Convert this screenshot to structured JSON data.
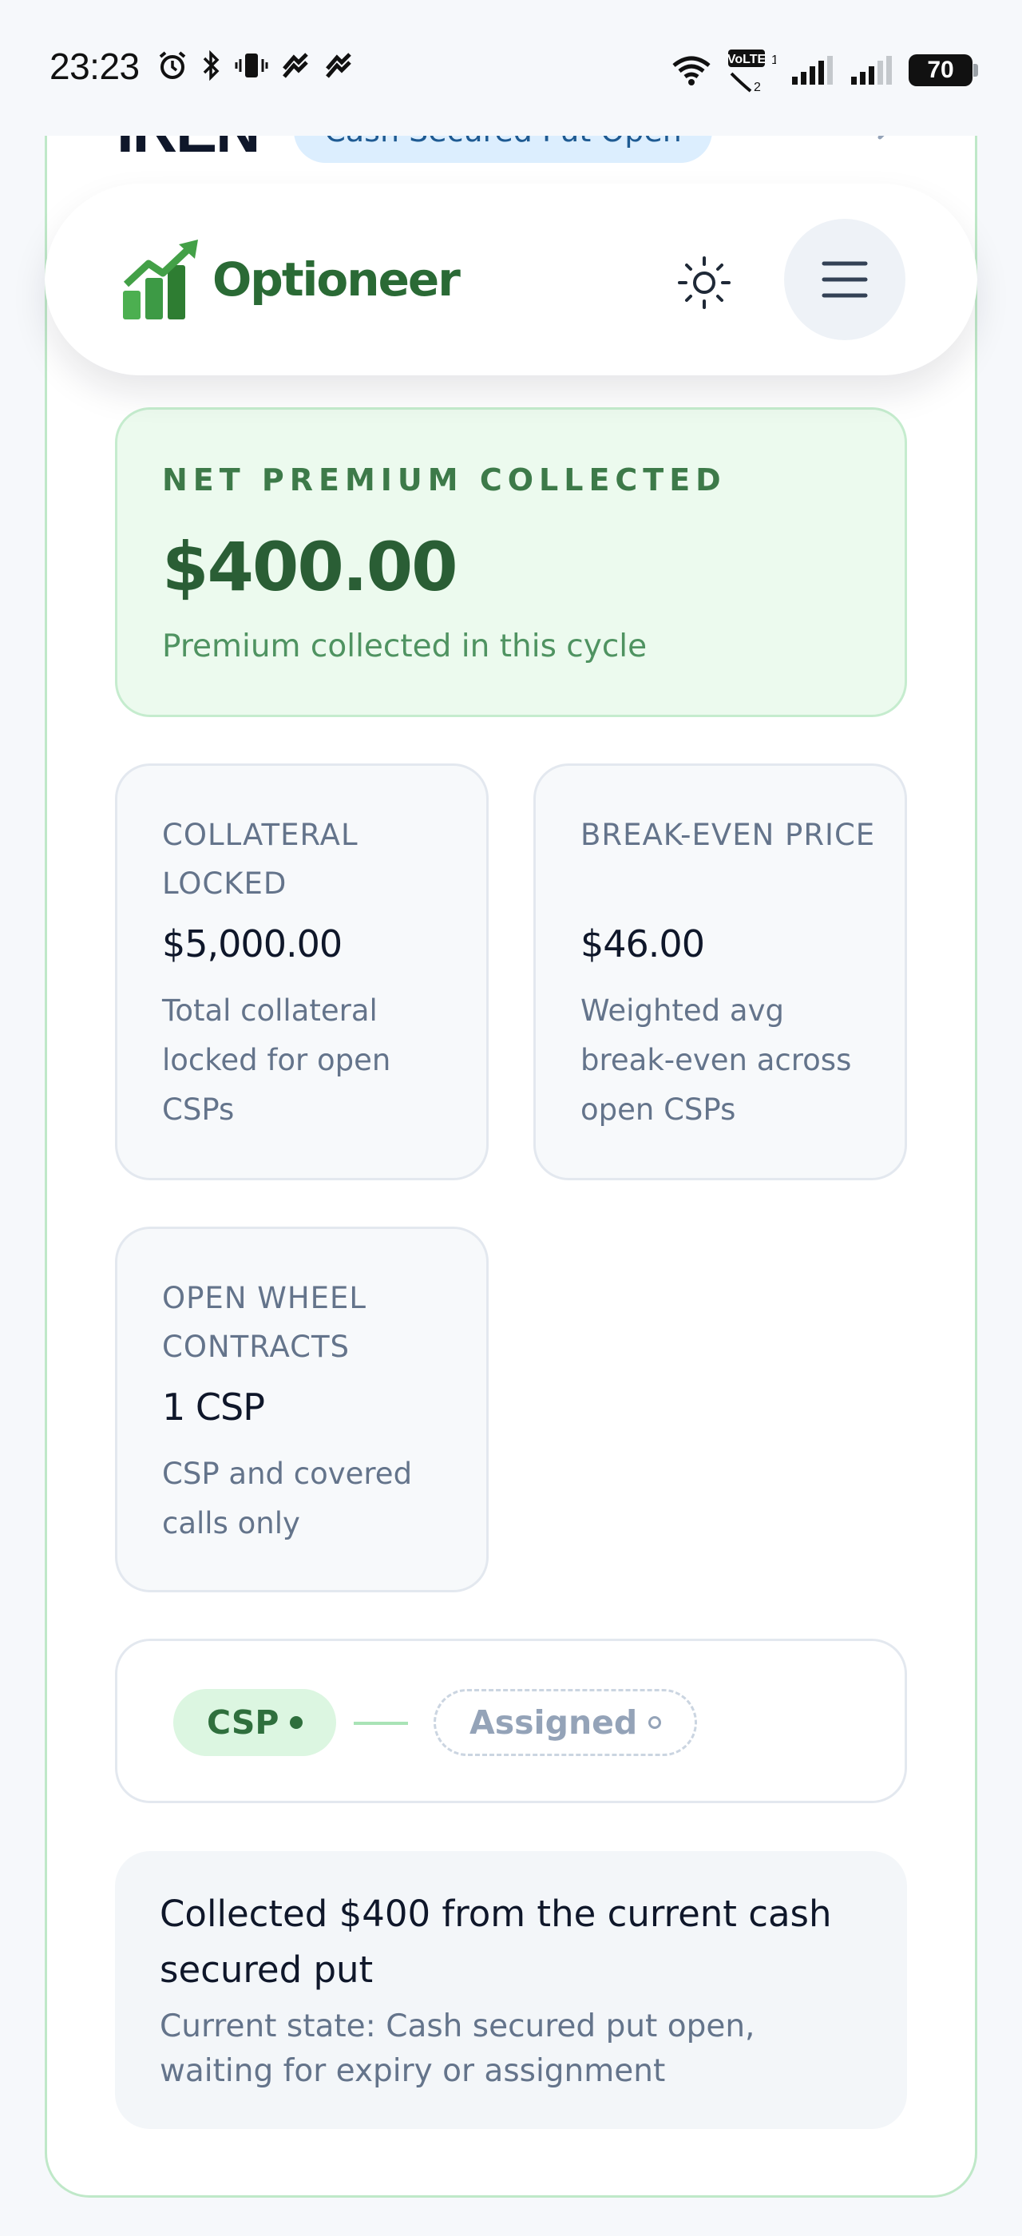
{
  "status_bar": {
    "time": "23:23",
    "left_icons": [
      "alarm-icon",
      "bluetooth-icon",
      "vibrate-icon",
      "signal-tie-icon",
      "signal-tie-icon"
    ],
    "right_icons": [
      "wifi-icon",
      "volte-icon",
      "signal-bars-icon",
      "signal-bars-icon"
    ],
    "volte_label": "VoLTE",
    "battery": "70"
  },
  "position": {
    "ticker": "IREN",
    "status": "Cash Secured Put Open"
  },
  "header": {
    "brand": "Optioneer",
    "theme_icon": "sun-icon",
    "menu_icon": "hamburger-icon"
  },
  "premium": {
    "label": "NET PREMIUM COLLECTED",
    "value": "$400.00",
    "sub": "Premium collected in this cycle"
  },
  "stats": [
    {
      "label": "COLLATERAL LOCKED",
      "value": "$5,000.00",
      "desc": "Total collateral locked for open CSPs"
    },
    {
      "label": "BREAK-EVEN PRICE",
      "value": "$46.00",
      "desc": "Weighted avg break-even across open CSPs"
    },
    {
      "label": "OPEN WHEEL CONTRACTS",
      "value": "1 CSP",
      "desc": "CSP and covered calls only"
    }
  ],
  "timeline": {
    "active": "CSP",
    "pending": "Assigned"
  },
  "summary": {
    "title": "Collected $400 from the current cash secured put",
    "desc": "Current state: Cash secured put open, waiting for expiry or assignment"
  },
  "colors": {
    "brand_green": "#2a6a35",
    "premium_bg": "#ecfaee",
    "pill_blue_bg": "#dceefe",
    "pill_blue_text": "#1e5a92"
  }
}
